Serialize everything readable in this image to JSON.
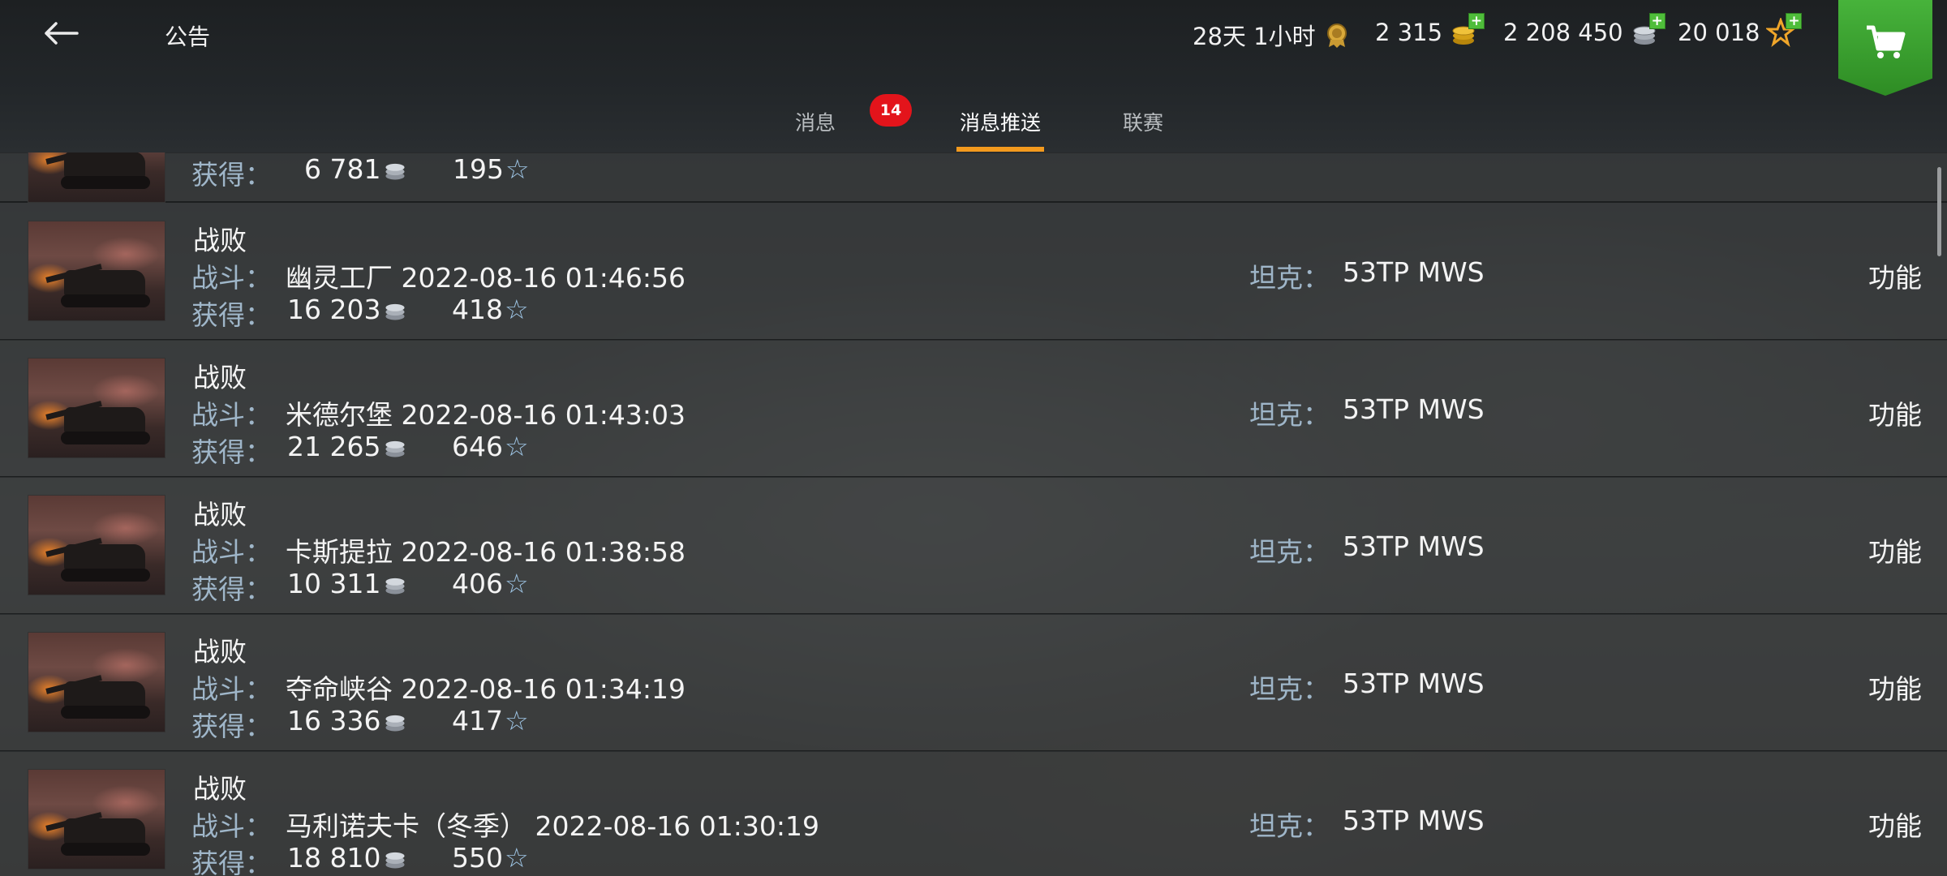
{
  "header": {
    "title": "公告",
    "premium_time": "28天 1小时",
    "gold": "2 315",
    "credits": "2 208 450",
    "free_xp": "20 018"
  },
  "tabs": [
    {
      "label": "消息",
      "badge": "14"
    },
    {
      "label": "消息推送"
    },
    {
      "label": "联赛"
    }
  ],
  "labels": {
    "battle": "战斗：",
    "earned": "获得：",
    "tank": "坦克：",
    "function": "功能"
  },
  "partial_row": {
    "credits": "6 781",
    "xp": "195"
  },
  "rows": [
    {
      "result": "战败",
      "battle": "幽灵工厂 2022-08-16 01:46:56",
      "credits": "16 203",
      "xp": "418",
      "tank": "53TP MWS"
    },
    {
      "result": "战败",
      "battle": "米德尔堡 2022-08-16 01:43:03",
      "credits": "21 265",
      "xp": "646",
      "tank": "53TP MWS"
    },
    {
      "result": "战败",
      "battle": "卡斯提拉 2022-08-16 01:38:58",
      "credits": "10 311",
      "xp": "406",
      "tank": "53TP MWS"
    },
    {
      "result": "战败",
      "battle": "夺命峡谷 2022-08-16 01:34:19",
      "credits": "16 336",
      "xp": "417",
      "tank": "53TP MWS"
    },
    {
      "result": "战败",
      "battle": "马利诺夫卡（冬季） 2022-08-16 01:30:19",
      "credits": "18 810",
      "xp": "550",
      "tank": "53TP MWS"
    }
  ],
  "colors": {
    "accent_tab": "#f39a1e",
    "badge": "#e3141b",
    "shop": "#3fa533",
    "label": "#9fb6c9"
  }
}
